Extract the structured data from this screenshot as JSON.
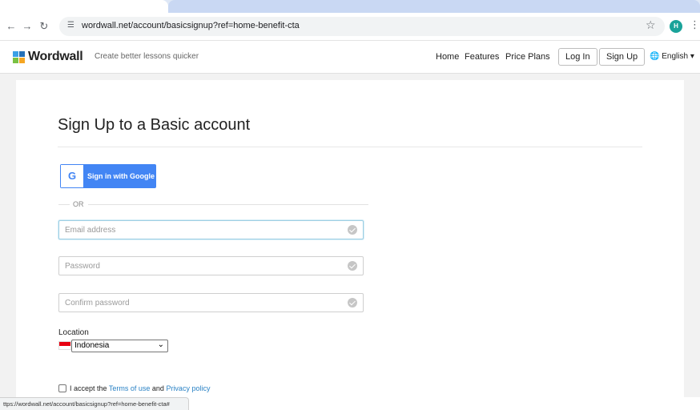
{
  "browser": {
    "tab_title": "",
    "url": "wordwall.net/account/basicsignup?ref=home-benefit-cta",
    "profile_initial": "H",
    "icons": [
      "back-arrow-icon",
      "forward-arrow-icon",
      "reload-icon",
      "site-info-icon",
      "star-icon",
      "profile-avatar",
      "menu-dots-icon"
    ]
  },
  "header": {
    "logo_text": "Wordwall",
    "tagline": "Create better lessons quicker",
    "nav": {
      "home": "Home",
      "features": "Features",
      "price_plans": "Price Plans"
    },
    "login_label": "Log In",
    "signup_label": "Sign Up",
    "language": "English",
    "logo_colors": [
      "#3ba0e6",
      "#2471b8",
      "#7ac143",
      "#f5a623"
    ]
  },
  "signup": {
    "title": "Sign Up to a Basic account",
    "google_label": "Sign in with Google",
    "or_label": "OR",
    "email_placeholder": "Email address",
    "password_placeholder": "Password",
    "confirm_placeholder": "Confirm password",
    "location_label": "Location",
    "location_value": "Indonesia",
    "terms_prefix": "I accept the ",
    "terms_link": "Terms of use",
    "terms_and": " and ",
    "privacy_link": "Privacy policy"
  },
  "status_bar": {
    "url": "ttps://wordwall.net/account/basicsignup?ref=home-benefit-cta#"
  },
  "colors": {
    "accent_blue": "#4285f4",
    "link_blue": "#2a82c5",
    "avatar_teal": "#1aa39a"
  }
}
